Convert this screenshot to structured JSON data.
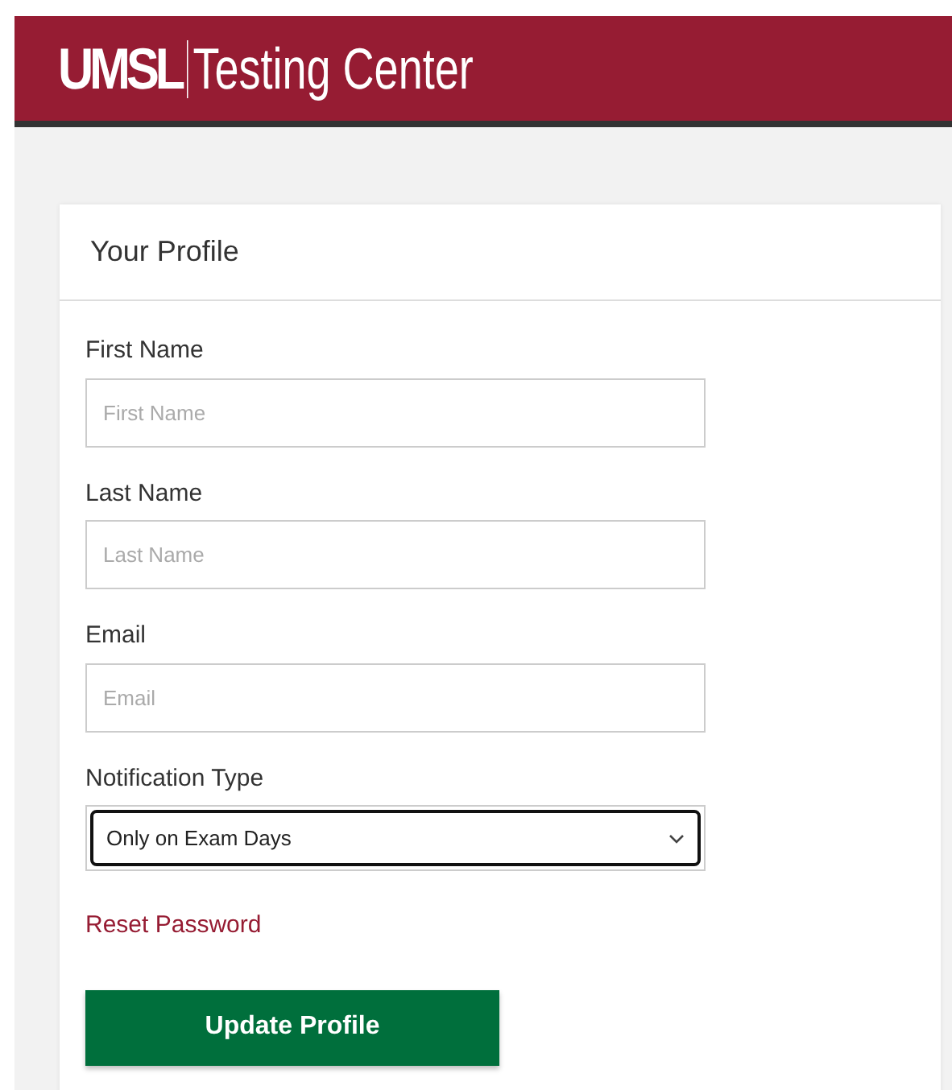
{
  "header": {
    "logo_bold": "UMSL",
    "logo_light": "Testing Center"
  },
  "card": {
    "title": "Your Profile"
  },
  "fields": [
    {
      "kind": "text",
      "label": "First Name",
      "placeholder": "First Name"
    },
    {
      "kind": "text",
      "label": "Last Name",
      "placeholder": "Last Name"
    },
    {
      "kind": "text",
      "label": "Email",
      "placeholder": "Email"
    },
    {
      "kind": "select",
      "label": "Notification Type",
      "value": "Only on Exam Days",
      "focused": true
    }
  ],
  "link": "Reset Password",
  "button": "Update Profile"
}
